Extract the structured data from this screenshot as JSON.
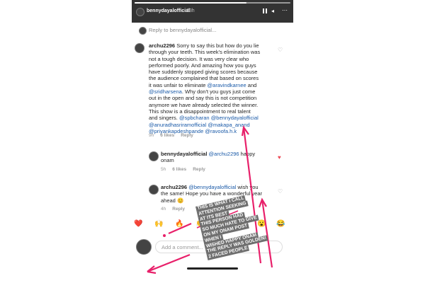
{
  "story": {
    "username": "bennydayalofficial",
    "time": "23h",
    "progress": 0.72,
    "more_icon": "more-icon",
    "pause_icon": "pause-icon",
    "mute_icon": "speaker-icon"
  },
  "reply_header": "Reply to bennydayalofficial...",
  "comments": [
    {
      "username": "archu2296",
      "text_before": "Sorry to say this but how do you lie through your teeth. This week's elimination was not a tough decision. It was very clear who performed poorly. And amazing how you guys have suddenly stopped giving scores because the audience complained that based on scores it was unfair to eliminate ",
      "mention1": "@aravindkarnee",
      "and1": " and ",
      "mention2": "@sridharsena",
      "text_after": ". Why don't you guys just come out in the open and say this is not competition anymore we have already selected the winner. This show is a disappointment to real talent and singers. ",
      "mentions_tail": [
        "@spbcharan",
        "@bennydayalofficial",
        "@anuradhasriramofficial",
        "@makapa_anand",
        "@priyankapdeshpande",
        "@ravoofa.h.k"
      ],
      "time": "9h",
      "likes": "6 likes",
      "reply": "Reply"
    },
    {
      "username": "bennydayalofficial",
      "mention": "@archu2296",
      "text": " happy onam",
      "time": "5h",
      "likes": "6 likes",
      "reply": "Reply"
    },
    {
      "username": "archu2296",
      "mention": "@bennydayalofficial",
      "text": " wish you the same! Hope you have a wonderful year ahead 😊",
      "time": "4h",
      "likes": "",
      "reply": "Reply"
    }
  ],
  "emojis": [
    "❤️",
    "🙌",
    "🔥",
    "👏",
    "😢",
    "😍",
    "😮",
    "😂"
  ],
  "add_comment_placeholder": "Add a comment...",
  "sticker_lines": [
    "THIS IS WHAT I CALL",
    "ATTENTION SEEKING",
    "AT ITS BEST",
    "THIS PERSON HAD",
    "SO MUCH HATE TO GIVE",
    "ON MY ONAM POST",
    "WHEN I",
    "WISHED HAPPY ONAM",
    "THE REPLY WAS GOLDEN!",
    "2 FACED PEOPLE"
  ],
  "colors": {
    "arrow": "#e8206a",
    "mention": "#1a5aa8",
    "heart_liked": "#ed4956",
    "sticker_bg": "#6f6f6f"
  }
}
